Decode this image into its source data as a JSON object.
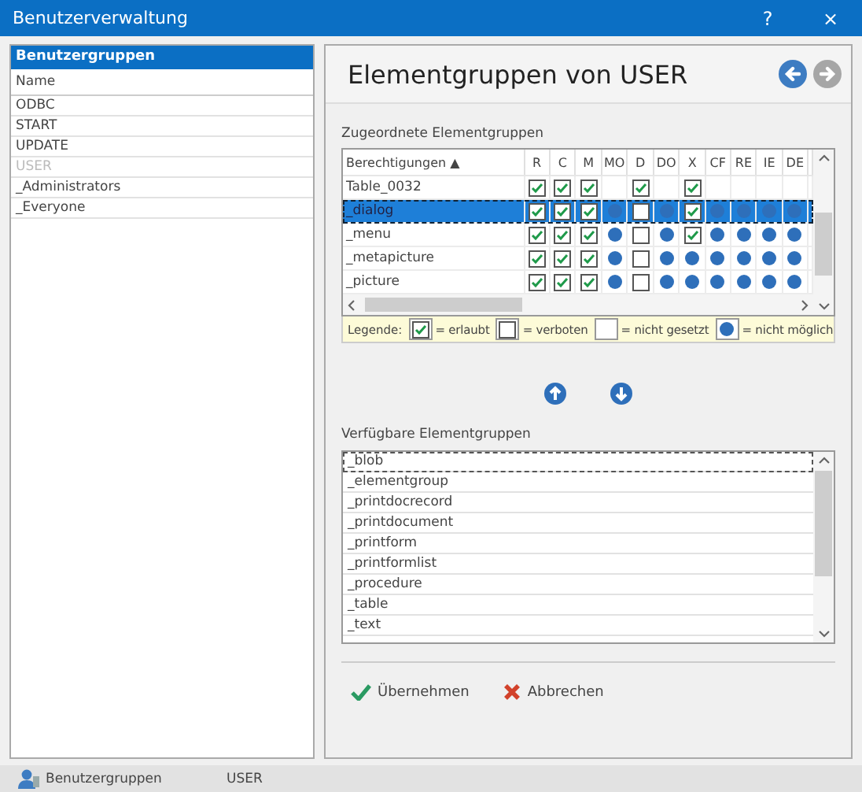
{
  "window": {
    "title": "Benutzerverwaltung",
    "help": "?",
    "close": "×"
  },
  "groups": {
    "title": "Benutzergruppen",
    "column": "Name",
    "items": [
      {
        "label": "ODBC",
        "disabled": false
      },
      {
        "label": "START",
        "disabled": false
      },
      {
        "label": "UPDATE",
        "disabled": false
      },
      {
        "label": "USER",
        "disabled": true
      },
      {
        "label": "_Administrators",
        "disabled": false
      },
      {
        "label": "_Everyone",
        "disabled": false
      }
    ]
  },
  "detail": {
    "title": "Elementgruppen von USER",
    "nav": [
      {
        "kind": "back",
        "disabled": false
      },
      {
        "kind": "forward",
        "disabled": true
      }
    ],
    "assigned": {
      "label": "Zugeordnete Elementgruppen",
      "columns": [
        "Berechtigungen ▲",
        "R",
        "C",
        "M",
        "MO",
        "D",
        "DO",
        "X",
        "CF",
        "RE",
        "IE",
        "DE"
      ],
      "rows": [
        {
          "name": "Table_0032",
          "selected": false,
          "cells": [
            {
              "kind": "allowed"
            },
            {
              "kind": "allowed"
            },
            {
              "kind": "allowed"
            },
            {
              "kind": "unset"
            },
            {
              "kind": "allowed"
            },
            {
              "kind": "unset"
            },
            {
              "kind": "allowed"
            },
            {
              "kind": "unset"
            },
            {
              "kind": "unset"
            },
            {
              "kind": "unset"
            },
            {
              "kind": "unset"
            }
          ]
        },
        {
          "name": "_dialog",
          "selected": true,
          "cells": [
            {
              "kind": "allowed"
            },
            {
              "kind": "allowed"
            },
            {
              "kind": "allowed"
            },
            {
              "kind": "impossible"
            },
            {
              "kind": "denied"
            },
            {
              "kind": "impossible"
            },
            {
              "kind": "allowed"
            },
            {
              "kind": "impossible"
            },
            {
              "kind": "impossible"
            },
            {
              "kind": "impossible"
            },
            {
              "kind": "impossible"
            }
          ]
        },
        {
          "name": "_menu",
          "selected": false,
          "cells": [
            {
              "kind": "allowed"
            },
            {
              "kind": "allowed"
            },
            {
              "kind": "allowed"
            },
            {
              "kind": "impossible"
            },
            {
              "kind": "denied"
            },
            {
              "kind": "impossible"
            },
            {
              "kind": "allowed"
            },
            {
              "kind": "impossible"
            },
            {
              "kind": "impossible"
            },
            {
              "kind": "impossible"
            },
            {
              "kind": "impossible"
            }
          ]
        },
        {
          "name": "_metapicture",
          "selected": false,
          "cells": [
            {
              "kind": "allowed"
            },
            {
              "kind": "allowed"
            },
            {
              "kind": "allowed"
            },
            {
              "kind": "impossible"
            },
            {
              "kind": "denied"
            },
            {
              "kind": "impossible"
            },
            {
              "kind": "impossible"
            },
            {
              "kind": "impossible"
            },
            {
              "kind": "impossible"
            },
            {
              "kind": "impossible"
            },
            {
              "kind": "impossible"
            }
          ]
        },
        {
          "name": "_picture",
          "selected": false,
          "cells": [
            {
              "kind": "allowed"
            },
            {
              "kind": "allowed"
            },
            {
              "kind": "allowed"
            },
            {
              "kind": "impossible"
            },
            {
              "kind": "denied"
            },
            {
              "kind": "impossible"
            },
            {
              "kind": "impossible"
            },
            {
              "kind": "impossible"
            },
            {
              "kind": "impossible"
            },
            {
              "kind": "impossible"
            },
            {
              "kind": "impossible"
            }
          ]
        }
      ],
      "legend": {
        "label": "Legende:",
        "items": [
          {
            "kind": "allowed",
            "label": "= erlaubt"
          },
          {
            "kind": "denied",
            "label": "= verboten"
          },
          {
            "kind": "unset",
            "label": "= nicht gesetzt"
          },
          {
            "kind": "impossible",
            "label": "= nicht möglich"
          }
        ]
      }
    },
    "move_buttons": [
      {
        "kind": "up"
      },
      {
        "kind": "down"
      }
    ],
    "available": {
      "label": "Verfügbare Elementgruppen",
      "items": [
        {
          "label": "_blob",
          "focused": true
        },
        {
          "label": "_elementgroup",
          "focused": false
        },
        {
          "label": "_printdocrecord",
          "focused": false
        },
        {
          "label": "_printdocument",
          "focused": false
        },
        {
          "label": "_printform",
          "focused": false
        },
        {
          "label": "_printformlist",
          "focused": false
        },
        {
          "label": "_procedure",
          "focused": false
        },
        {
          "label": "_table",
          "focused": false
        },
        {
          "label": "_text",
          "focused": false
        }
      ]
    },
    "buttons": [
      {
        "kind": "apply",
        "label": "Übernehmen"
      },
      {
        "kind": "cancel",
        "label": "Abbrechen"
      }
    ]
  },
  "status_bar": {
    "section": "Benutzergruppen",
    "user": "USER"
  }
}
